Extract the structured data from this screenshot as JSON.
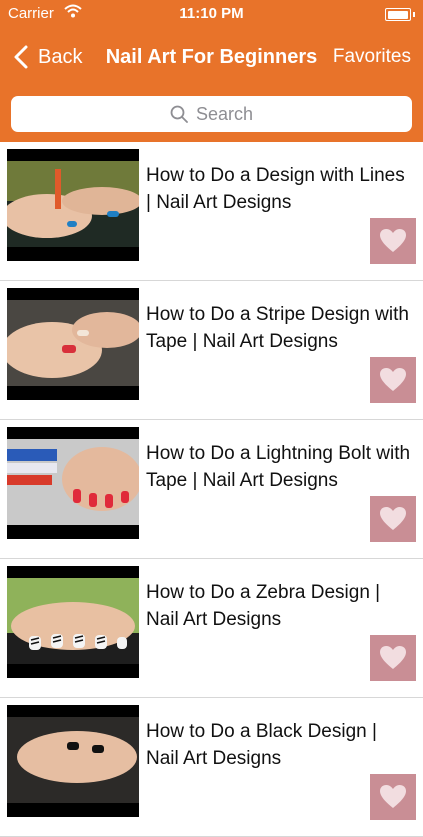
{
  "status_bar": {
    "carrier": "Carrier",
    "time": "11:10 PM"
  },
  "nav": {
    "back_label": "Back",
    "title": "Nail Art For Beginners",
    "favorites_label": "Favorites"
  },
  "search": {
    "placeholder": "Search"
  },
  "items": [
    {
      "title": "How to Do a Design with Lines | Nail Art Designs"
    },
    {
      "title": "How to Do a Stripe Design with Tape | Nail Art Designs"
    },
    {
      "title": "How to Do a Lightning Bolt with Tape | Nail Art Designs"
    },
    {
      "title": "How to Do a Zebra Design | Nail Art Designs"
    },
    {
      "title": "How to Do a Black Design | Nail Art Designs"
    }
  ],
  "colors": {
    "accent": "#e8732a",
    "heart_bg": "#c98e95"
  },
  "icons": {
    "back": "chevron-left-icon",
    "search": "search-icon",
    "favorite": "heart-icon",
    "wifi": "wifi-icon",
    "battery": "battery-icon"
  }
}
